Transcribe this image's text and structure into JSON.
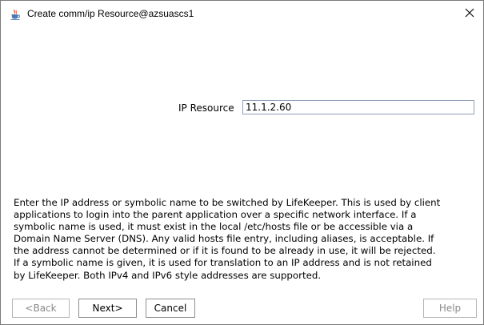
{
  "window": {
    "title": "Create comm/ip Resource@azsuascs1",
    "app_icon": "java-cup-icon",
    "close_icon": "close-icon"
  },
  "form": {
    "ip_resource_label": "IP Resource",
    "ip_resource_value": "11.1.2.60"
  },
  "description": {
    "lines": [
      "Enter the IP address or symbolic name to be switched by LifeKeeper. This is used by client",
      "applications to login into the parent application over a specific network interface. If a",
      "symbolic name is used, it must exist in the local /etc/hosts file or be accessible via a",
      "Domain Name Server (DNS). Any valid hosts file entry, including aliases, is acceptable. If",
      "the address cannot be determined or if it is found to be already in use, it will be rejected.",
      "If a symbolic name is given, it is used for translation to an IP address and is not retained",
      "by LifeKeeper. Both IPv4 and IPv6 style addresses are supported."
    ]
  },
  "buttons": {
    "back_label": "<Back",
    "back_enabled": false,
    "next_label": "Next>",
    "next_enabled": true,
    "cancel_label": "Cancel",
    "cancel_enabled": true,
    "help_label": "Help",
    "help_enabled": false
  }
}
